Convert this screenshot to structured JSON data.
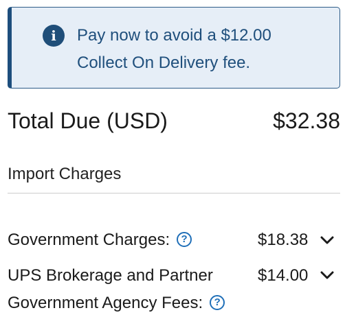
{
  "alert": {
    "icon": "info-icon",
    "line1": "Pay now to avoid a $12.00",
    "line2": "Collect On Delivery fee."
  },
  "total": {
    "label": "Total Due (USD)",
    "value": "$32.38"
  },
  "import_charges": {
    "title": "Import Charges",
    "items": [
      {
        "label_line1": "Government Charges:",
        "amount": "$18.38",
        "help_icon": "question-circle-icon",
        "expand_icon": "chevron-down-icon"
      },
      {
        "label_line1": "UPS Brokerage and Partner",
        "label_line2": "Government Agency Fees:",
        "amount": "$14.00",
        "help_icon": "question-circle-icon",
        "expand_icon": "chevron-down-icon"
      }
    ]
  },
  "colors": {
    "alert_bg": "#e6eef7",
    "alert_accent": "#1d4e7d",
    "help_icon": "#1f6fb8",
    "text": "#1a1a1a"
  }
}
